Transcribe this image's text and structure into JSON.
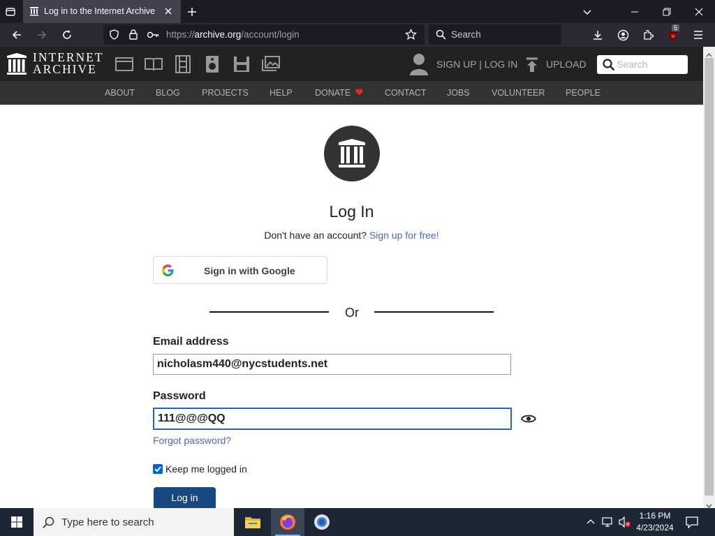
{
  "browser": {
    "tab_title": "Log in to the Internet Archive",
    "url_prefix": "https://",
    "url_host": "archive.org",
    "url_path": "/account/login",
    "search_placeholder": "Search",
    "ublock_badge": "5"
  },
  "ia_header": {
    "logo_line1": "INTERNET",
    "logo_line2": "ARCHIVE",
    "signup_login": "SIGN UP | LOG IN",
    "upload": "UPLOAD",
    "search_placeholder": "Search",
    "nav": [
      "ABOUT",
      "BLOG",
      "PROJECTS",
      "HELP",
      "DONATE",
      "CONTACT",
      "JOBS",
      "VOLUNTEER",
      "PEOPLE"
    ]
  },
  "login": {
    "title": "Log In",
    "no_account": "Don't have an account?",
    "signup_link": "Sign up for free!",
    "google_button": "Sign in with Google",
    "or": "Or",
    "email_label": "Email address",
    "email_value": "nicholasm440@nycstudents.net",
    "password_label": "Password",
    "password_value": "111@@@QQ",
    "forgot": "Forgot password?",
    "keep_logged_in": "Keep me logged in",
    "keep_logged_in_checked": true,
    "login_button": "Log in"
  },
  "taskbar": {
    "search_placeholder": "Type here to search",
    "time": "1:16 PM",
    "date": "4/23/2024"
  },
  "colors": {
    "accent_link": "#4b64c8",
    "login_button": "#194880",
    "focus_border": "#2563c4",
    "donate_heart": "#e02b2b"
  }
}
